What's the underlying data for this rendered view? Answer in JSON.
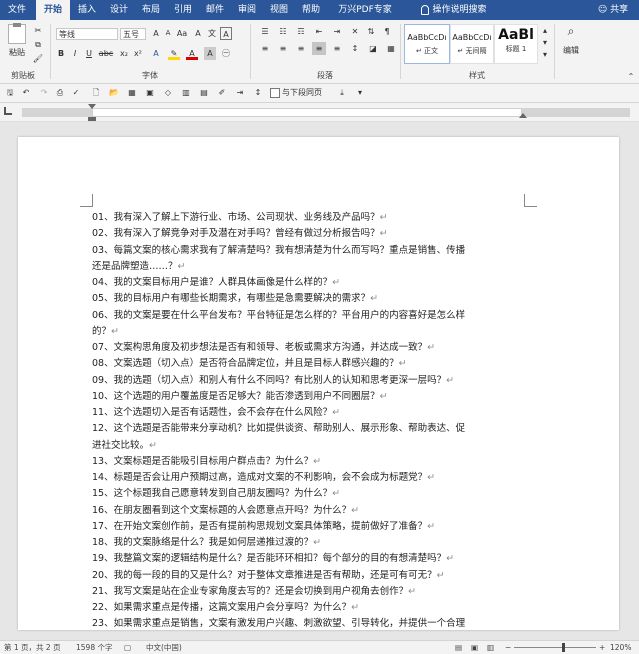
{
  "tabs": [
    "文件",
    "开始",
    "插入",
    "设计",
    "布局",
    "引用",
    "邮件",
    "审阅",
    "视图",
    "帮助",
    "万兴PDF专家",
    "操作说明搜索"
  ],
  "active_tab": "开始",
  "share_label": "共享",
  "clipboard": {
    "paste_label": "粘贴",
    "group_label": "剪贴板"
  },
  "font": {
    "name": "等线",
    "size": "五号",
    "group_label": "字体"
  },
  "paragraph": {
    "group_label": "段落"
  },
  "styles": {
    "items": [
      {
        "preview": "AaBbCcDı",
        "label": "↵ 正文"
      },
      {
        "preview": "AaBbCcDı",
        "label": "↵ 无间隔"
      },
      {
        "preview": "AaBl",
        "label": "标题 1"
      }
    ],
    "group_label": "样式"
  },
  "editing": {
    "label": "编辑"
  },
  "qat": {
    "page_layout_label": "与下段同页"
  },
  "document": {
    "lines": [
      "01、我有深入了解上下游行业、市场、公司现状、业务线及产品吗？",
      "02、我有深入了解竞争对手及潜在对手吗？曾经有做过分析报告吗？",
      "03、每篇文案的核心需求我有了解清楚吗？我有想清楚为什么而写吗？重点是销售、传播",
      "还是品牌塑造……？",
      "04、我的文案目标用户是谁？人群具体画像是什么样的？",
      "05、我的目标用户有哪些长期需求，有哪些是急需要解决的需求？",
      "06、我的文案是要在什么平台发布？平台特征是怎么样的？平台用户的内容喜好是怎么样",
      "的？",
      "07、文案构思角度及初步想法是否有和领导、老板或需求方沟通，并达成一致？",
      "08、文案选题（切入点）是否符合品牌定位，并且是目标人群感兴趣的？",
      "09、我的选题（切入点）和别人有什么不同吗？有比别人的认知和思考更深一层吗？",
      "10、这个选题的用户覆盖度是否足够大？能否渗透到用户不同圈层？",
      "11、这个选题切入是否有话题性，会不会存在什么风险？",
      "12、这个选题是否能带来分享动机？比如提供谈资、帮助别人、展示形象、帮助表达、促",
      "进社交比较。",
      "13、文案标题是否能吸引目标用户群点击？为什么？",
      "14、标题是否会让用户预期过高，造成对文案的不利影响，会不会成为标题党？",
      "15、这个标题我自己愿意转发到自己朋友圈吗？为什么？",
      "16、在朋友圈看到这个文案标题的人会愿意点开吗？为什么？",
      "17、在开始文案创作前，是否有提前构思规划文案具体策略，提前做好了准备？",
      "18、我的文案脉络是什么？我是如何层递推过渡的？",
      "19、我整篇文案的逻辑结构是什么？是否能环环相扣？每个部分的目的有想清楚吗？",
      "20、我的每一段的目的又是什么？对于整体文章推进是否有帮助，还是可有可无？",
      "21、我写文案是站在企业专家角度去写的？还是会切换到用户视角去创作？",
      "22、如果需求重点是传播，这篇文案用户会分享吗？为什么？",
      "23、如果需求重点是销售，文案有激发用户兴趣、刺激欲望、引导转化，并提供一个合理"
    ],
    "para_marks": [
      true,
      true,
      false,
      true,
      true,
      true,
      false,
      true,
      true,
      true,
      true,
      true,
      true,
      false,
      true,
      true,
      true,
      true,
      true,
      true,
      true,
      true,
      true,
      true,
      true,
      false
    ]
  },
  "status": {
    "page": "第 1 页，共 2 页",
    "words": "1598 个字",
    "language": "中文(中国)",
    "zoom": "120%"
  },
  "colors": {
    "accent": "#2b579a",
    "page": "#ffffff"
  }
}
